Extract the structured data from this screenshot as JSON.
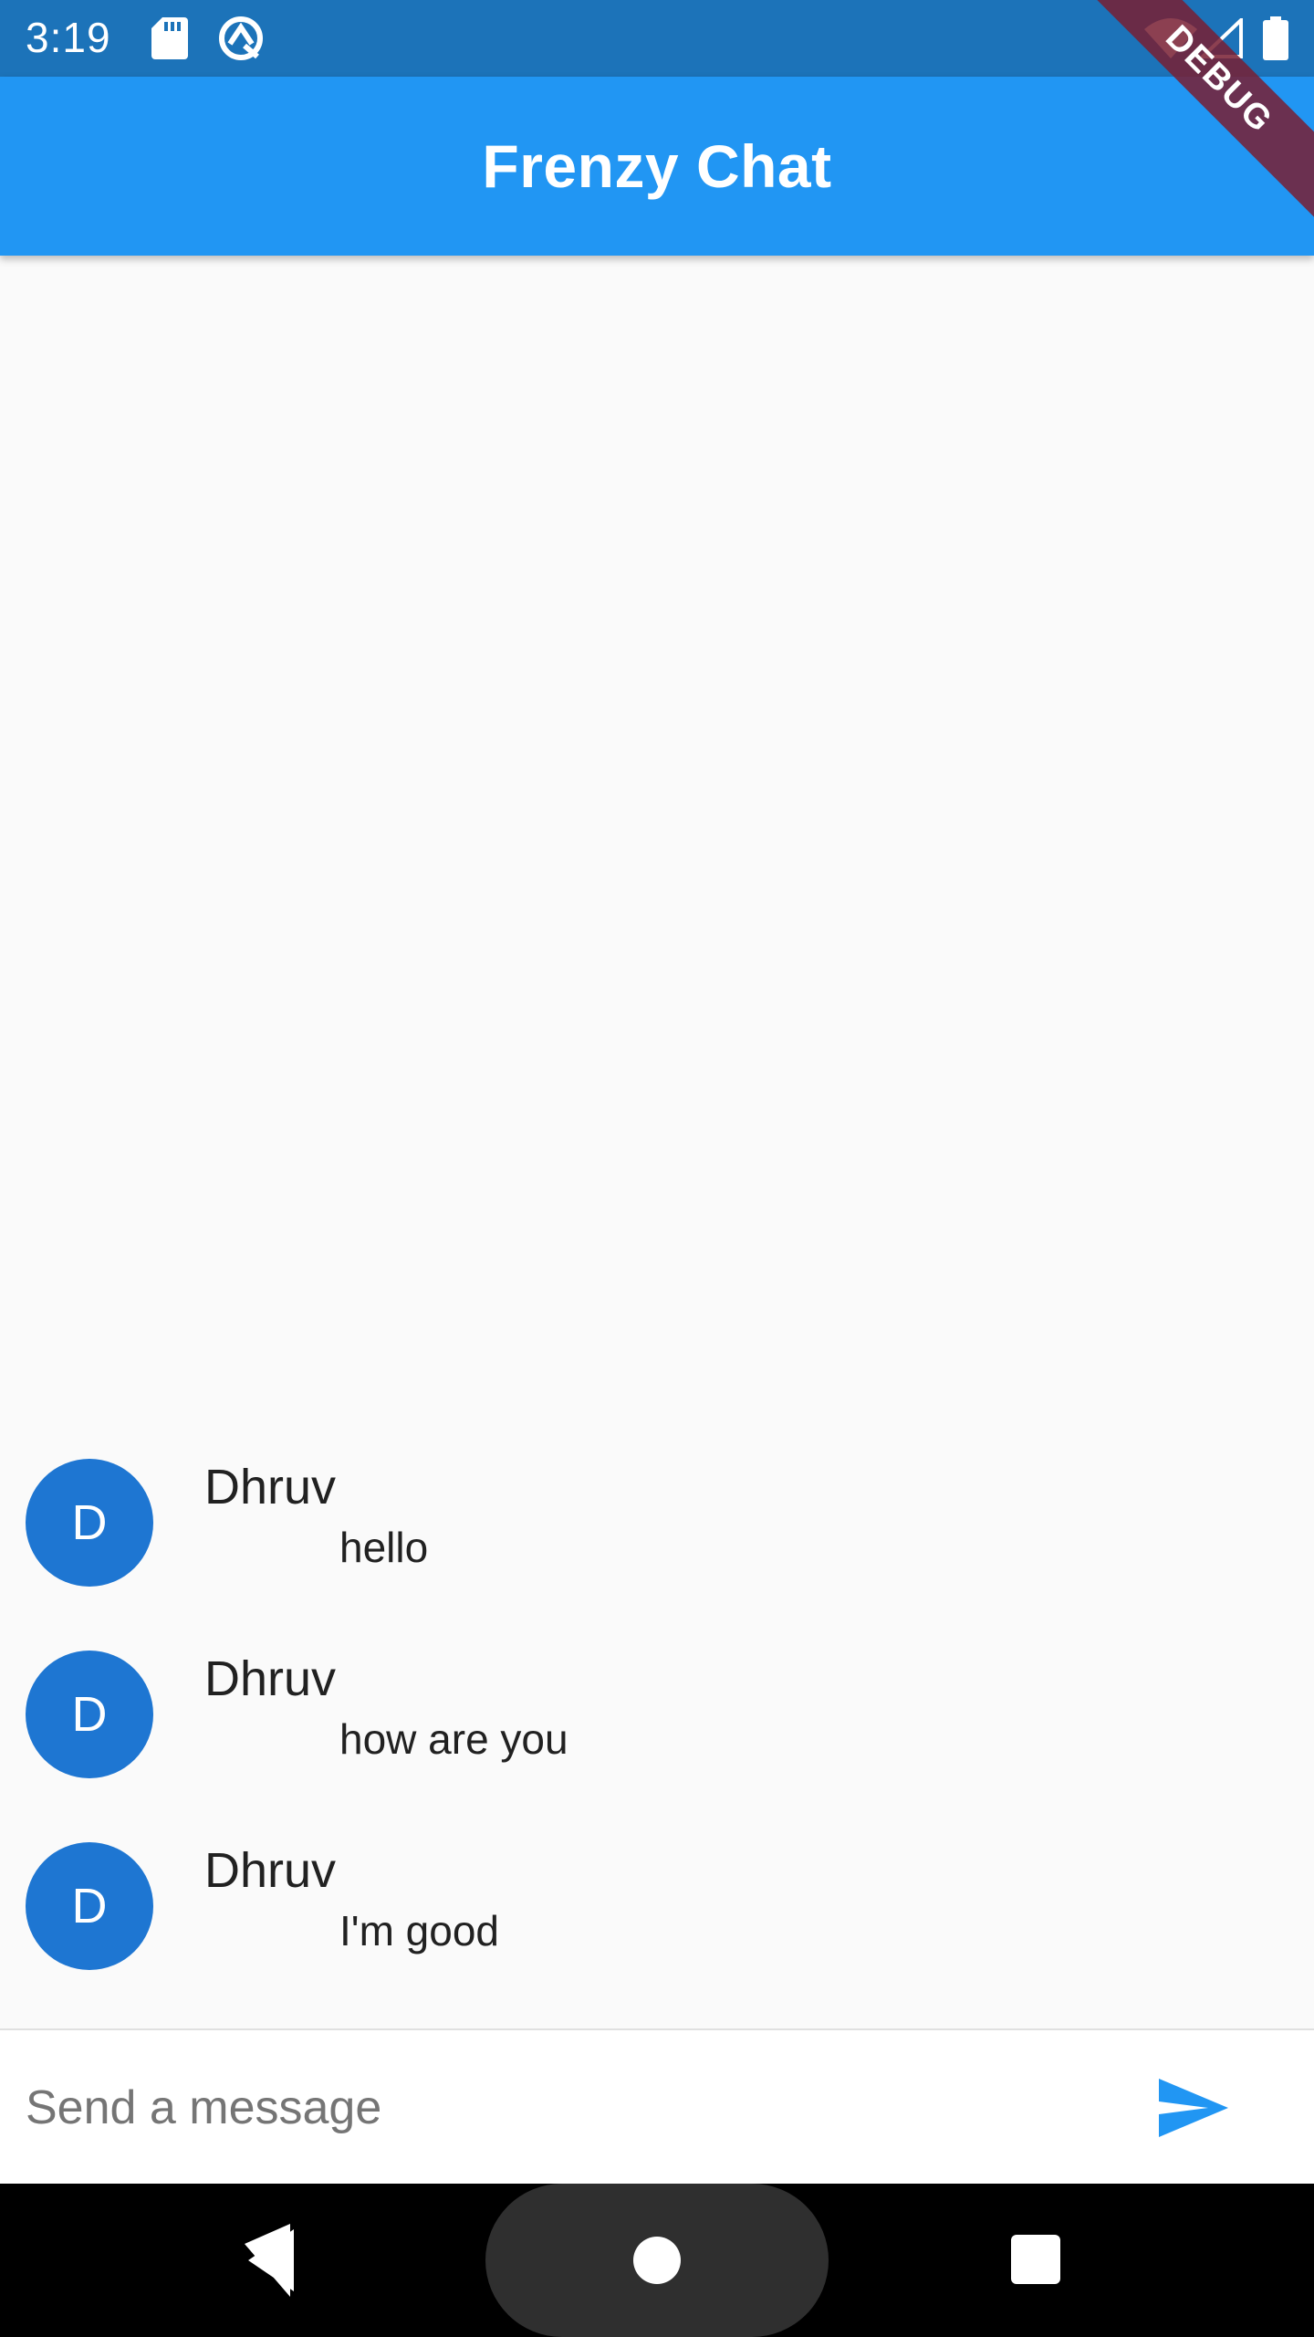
{
  "status_bar": {
    "time": "3:19",
    "icons": [
      "sd-card-icon",
      "sync-icon",
      "wifi-icon",
      "signal-icon",
      "battery-icon"
    ]
  },
  "app_bar": {
    "title": "Frenzy Chat",
    "color": "#2196f3"
  },
  "debug_banner": {
    "label": "DEBUG"
  },
  "messages": [
    {
      "avatar_initial": "D",
      "sender": "Dhruv",
      "text": "hello"
    },
    {
      "avatar_initial": "D",
      "sender": "Dhruv",
      "text": "how are you"
    },
    {
      "avatar_initial": "D",
      "sender": "Dhruv",
      "text": "I'm good"
    }
  ],
  "composer": {
    "placeholder": "Send a message",
    "value": "",
    "send_icon": "send-icon",
    "accent": "#2196f3"
  },
  "nav_bar": {
    "icons": [
      "back-icon",
      "home-icon",
      "recents-icon"
    ]
  }
}
